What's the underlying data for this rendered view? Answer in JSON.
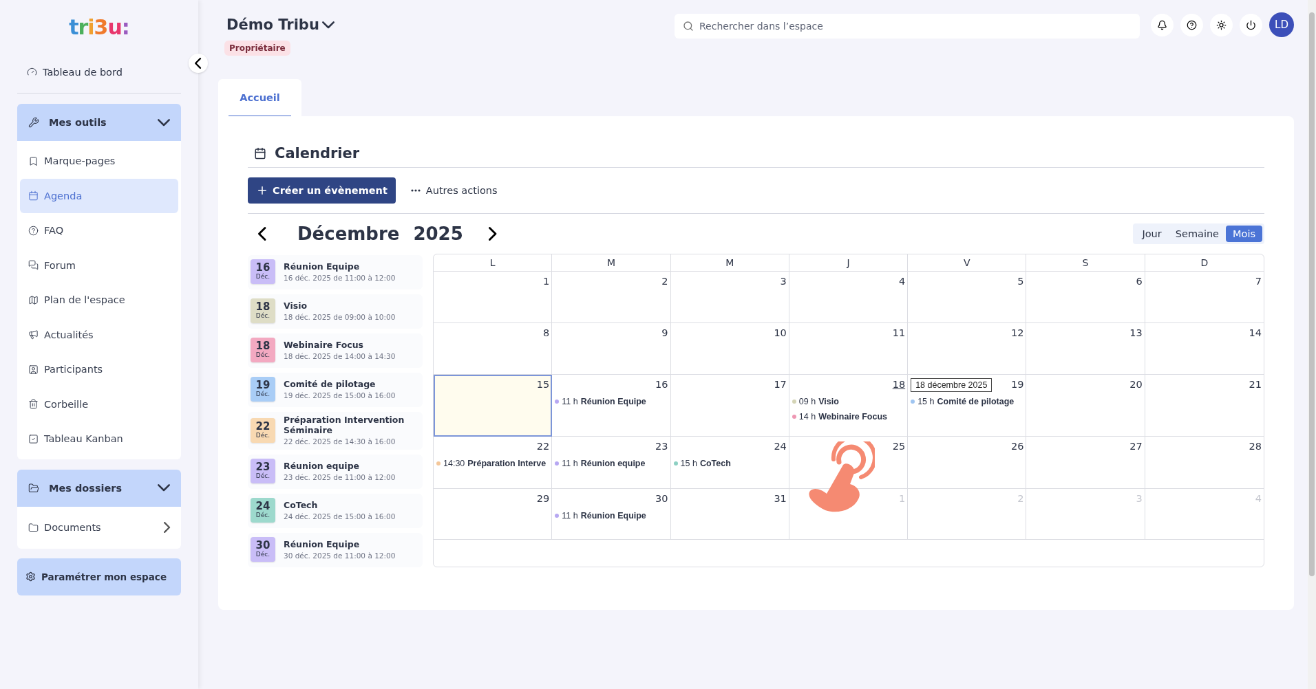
{
  "sidebar": {
    "logo": "tri3u:",
    "dashboard": {
      "label": "Tableau de bord"
    },
    "sections": [
      {
        "title": "Mes outils",
        "expanded": true,
        "items": [
          {
            "label": "Marque-pages",
            "selected": false
          },
          {
            "label": "Agenda",
            "selected": true
          },
          {
            "label": "FAQ",
            "selected": false
          },
          {
            "label": "Forum",
            "selected": false
          },
          {
            "label": "Plan de l'espace",
            "selected": false
          },
          {
            "label": "Actualités",
            "selected": false
          },
          {
            "label": "Participants",
            "selected": false
          },
          {
            "label": "Corbeille",
            "selected": false
          },
          {
            "label": "Tableau Kanban",
            "selected": false
          }
        ]
      },
      {
        "title": "Mes dossiers",
        "expanded": true,
        "items": [
          {
            "label": "Documents",
            "selected": false
          }
        ]
      }
    ],
    "settings_button": "Paramétrer mon espace"
  },
  "header": {
    "space_name": "Démo Tribu",
    "role_badge": "Propriétaire",
    "search": {
      "placeholder": "Rechercher dans l’espace"
    },
    "avatar": "LD"
  },
  "tabs": [
    {
      "label": "Accueil",
      "selected": true
    }
  ],
  "calendar": {
    "title": "Calendrier",
    "create_button": "Créer un évènement",
    "more_actions": "Autres actions",
    "month": "Décembre",
    "year": "2025",
    "views": [
      {
        "label": "Jour",
        "selected": false
      },
      {
        "label": "Semaine",
        "selected": false
      },
      {
        "label": "Mois",
        "selected": true
      }
    ],
    "upcoming": [
      {
        "day": "16",
        "month": "Déc.",
        "title": "Réunion Equipe",
        "when": "16 déc. 2025 de 11:00 à 12:00",
        "color": "#c9bdf7"
      },
      {
        "day": "18",
        "month": "Déc.",
        "title": "Visio",
        "when": "18 déc. 2025 de 09:00 à 10:00",
        "color": "#deddc6"
      },
      {
        "day": "18",
        "month": "Déc.",
        "title": "Webinaire Focus",
        "when": "18 déc. 2025 de 14:00 à 14:30",
        "color": "#f3a9c1"
      },
      {
        "day": "19",
        "month": "Déc.",
        "title": "Comité de pilotage",
        "when": "19 déc. 2025 de 15:00 à 16:00",
        "color": "#a9cdf6"
      },
      {
        "day": "22",
        "month": "Déc.",
        "title": "Préparation Intervention Séminaire",
        "when": "22 déc. 2025 de 14:30 à 16:00",
        "color": "#f8d9b2"
      },
      {
        "day": "23",
        "month": "Déc.",
        "title": "Réunion equipe",
        "when": "23 déc. 2025 de 11:00 à 12:00",
        "color": "#c9bdf7"
      },
      {
        "day": "24",
        "month": "Déc.",
        "title": "CoTech",
        "when": "24 déc. 2025 de 15:00 à 16:00",
        "color": "#9dd9cd"
      },
      {
        "day": "30",
        "month": "Déc.",
        "title": "Réunion Equipe",
        "when": "30 déc. 2025 de 11:00 à 12:00",
        "color": "#c9bdf7"
      }
    ],
    "weekdays": [
      "L",
      "M",
      "M",
      "J",
      "V",
      "S",
      "D"
    ],
    "weeks": [
      [
        {
          "day": "1",
          "outside": false,
          "today": false,
          "hovered": false
        },
        {
          "day": "2",
          "outside": false,
          "today": false,
          "hovered": false
        },
        {
          "day": "3",
          "outside": false,
          "today": false,
          "hovered": false
        },
        {
          "day": "4",
          "outside": false,
          "today": false,
          "hovered": false
        },
        {
          "day": "5",
          "outside": false,
          "today": false,
          "hovered": false
        },
        {
          "day": "6",
          "outside": false,
          "today": false,
          "hovered": false
        },
        {
          "day": "7",
          "outside": false,
          "today": false,
          "hovered": false
        }
      ],
      [
        {
          "day": "8",
          "outside": false,
          "today": false,
          "hovered": false
        },
        {
          "day": "9",
          "outside": false,
          "today": false,
          "hovered": false
        },
        {
          "day": "10",
          "outside": false,
          "today": false,
          "hovered": false
        },
        {
          "day": "11",
          "outside": false,
          "today": false,
          "hovered": false
        },
        {
          "day": "12",
          "outside": false,
          "today": false,
          "hovered": false
        },
        {
          "day": "13",
          "outside": false,
          "today": false,
          "hovered": false
        },
        {
          "day": "14",
          "outside": false,
          "today": false,
          "hovered": false
        }
      ],
      [
        {
          "day": "15",
          "outside": false,
          "today": true,
          "hovered": false
        },
        {
          "day": "16",
          "outside": false,
          "today": false,
          "hovered": false,
          "events": [
            {
              "time": "11 h",
              "title": "Réunion Equipe",
              "color": "#b7a8f2"
            }
          ]
        },
        {
          "day": "17",
          "outside": false,
          "today": false,
          "hovered": false
        },
        {
          "day": "18",
          "outside": false,
          "today": false,
          "hovered": true,
          "events": [
            {
              "time": "09 h",
              "title": "Visio",
              "color": "#d4d4b6"
            },
            {
              "time": "14 h",
              "title": "Webinaire Focus",
              "color": "#ee97b3"
            }
          ]
        },
        {
          "day": "19",
          "outside": false,
          "today": false,
          "hovered": false,
          "events": [
            {
              "time": "15 h",
              "title": "Comité de pilotage",
              "color": "#9fc5f1"
            }
          ]
        },
        {
          "day": "20",
          "outside": false,
          "today": false,
          "hovered": false
        },
        {
          "day": "21",
          "outside": false,
          "today": false,
          "hovered": false
        }
      ],
      [
        {
          "day": "22",
          "outside": false,
          "today": false,
          "hovered": false,
          "events": [
            {
              "time": "14:30",
              "title": "Préparation Interve",
              "color": "#f4c79a"
            }
          ]
        },
        {
          "day": "23",
          "outside": false,
          "today": false,
          "hovered": false,
          "events": [
            {
              "time": "11 h",
              "title": "Réunion equipe",
              "color": "#b7a8f2"
            }
          ]
        },
        {
          "day": "24",
          "outside": false,
          "today": false,
          "hovered": false,
          "events": [
            {
              "time": "15 h",
              "title": "CoTech",
              "color": "#8dd0c3"
            }
          ]
        },
        {
          "day": "25",
          "outside": false,
          "today": false,
          "hovered": false
        },
        {
          "day": "26",
          "outside": false,
          "today": false,
          "hovered": false
        },
        {
          "day": "27",
          "outside": false,
          "today": false,
          "hovered": false
        },
        {
          "day": "28",
          "outside": false,
          "today": false,
          "hovered": false
        }
      ],
      [
        {
          "day": "29",
          "outside": false,
          "today": false,
          "hovered": false
        },
        {
          "day": "30",
          "outside": false,
          "today": false,
          "hovered": false,
          "events": [
            {
              "time": "11 h",
              "title": "Réunion Equipe",
              "color": "#b7a8f2"
            }
          ]
        },
        {
          "day": "31",
          "outside": false,
          "today": false,
          "hovered": false
        },
        {
          "day": "1",
          "outside": true,
          "today": false,
          "hovered": false
        },
        {
          "day": "2",
          "outside": true,
          "today": false,
          "hovered": false
        },
        {
          "day": "3",
          "outside": true,
          "today": false,
          "hovered": false
        },
        {
          "day": "4",
          "outside": true,
          "today": false,
          "hovered": false
        }
      ]
    ],
    "tooltip": "18 décembre 2025"
  }
}
